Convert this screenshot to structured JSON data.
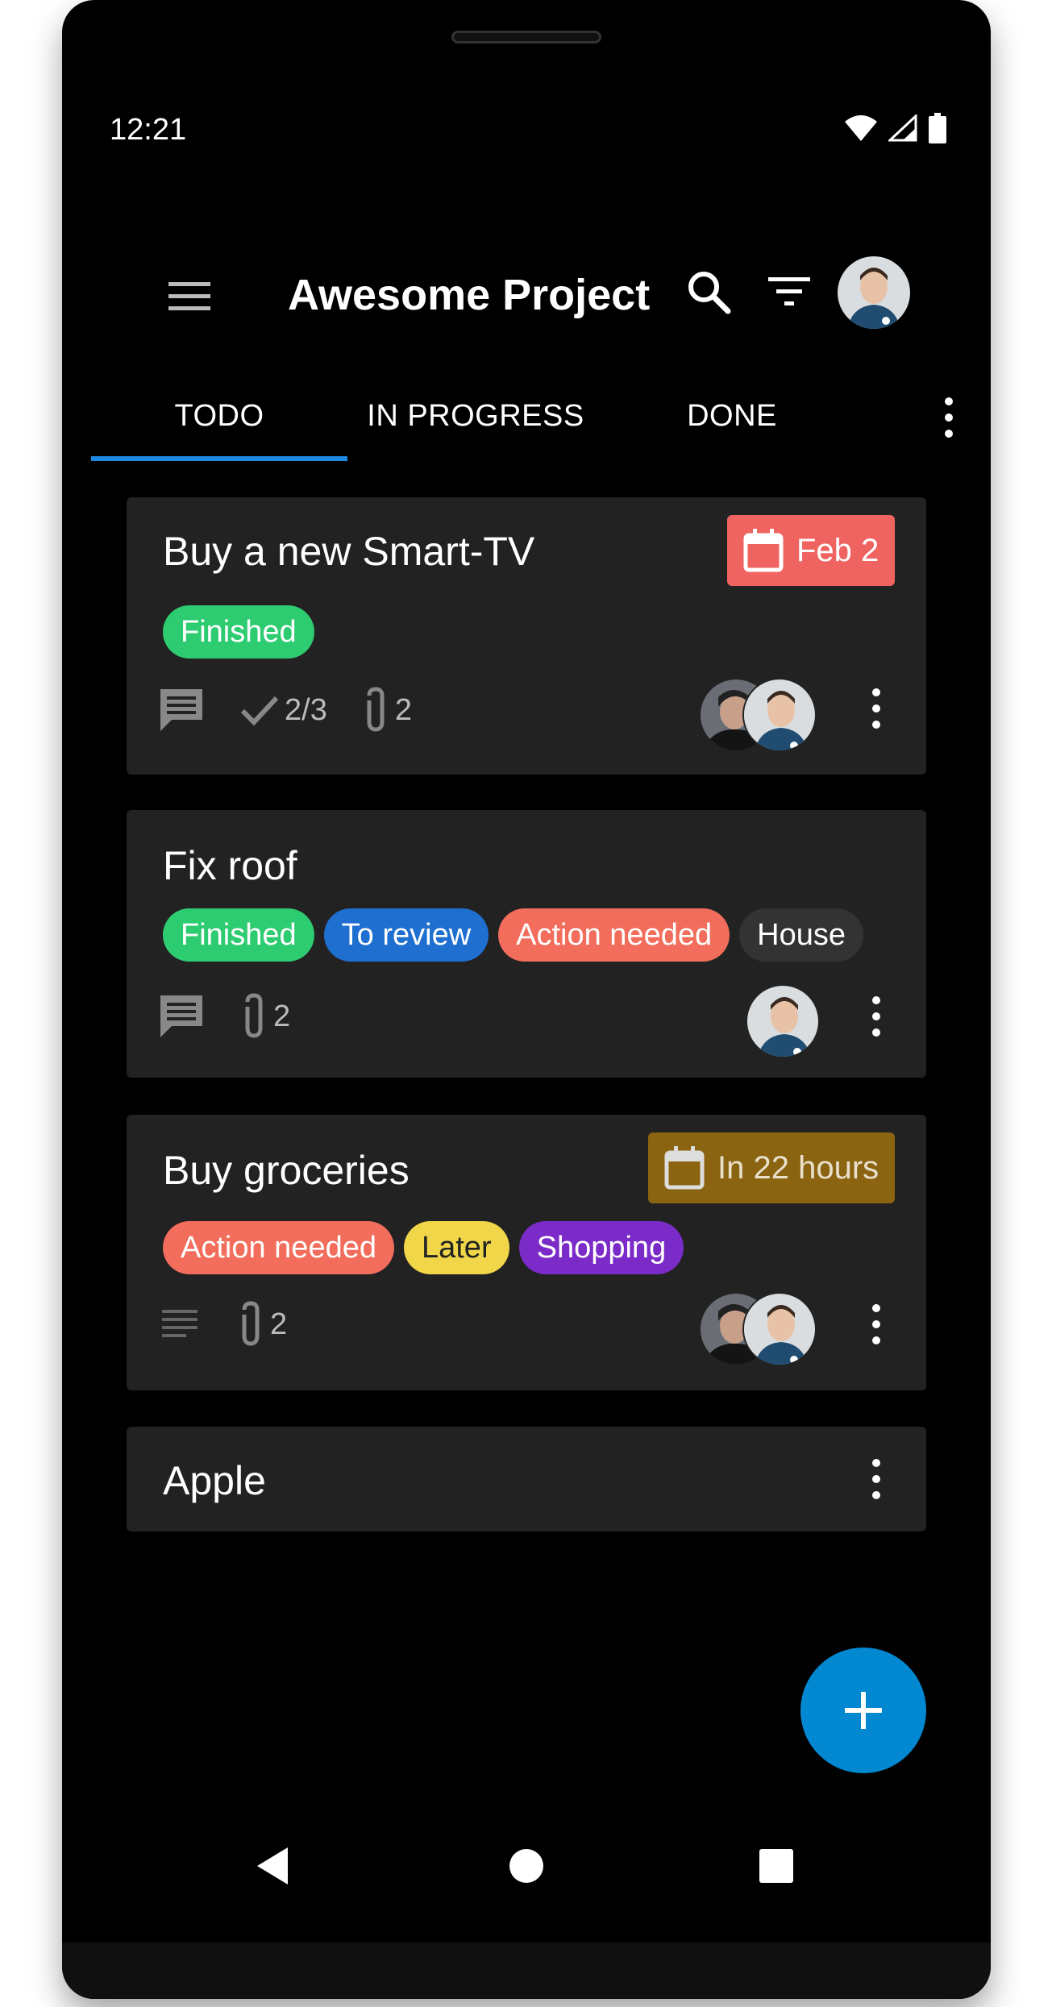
{
  "status_bar": {
    "time": "12:21"
  },
  "app_bar": {
    "title": "Awesome Project"
  },
  "tabs": [
    {
      "label": "TODO",
      "selected": true
    },
    {
      "label": "IN PROGRESS",
      "selected": false
    },
    {
      "label": "DONE",
      "selected": false
    }
  ],
  "cards": [
    {
      "title": "Buy a new Smart-TV",
      "date": "Feb 2",
      "date_color": "#ef6461",
      "labels": [
        {
          "text": "Finished",
          "bg": "#2ecc71",
          "fg": "#ffffff"
        }
      ],
      "checklist": "2/3",
      "attachments": "2"
    },
    {
      "title": "Fix roof",
      "labels": [
        {
          "text": "Finished",
          "bg": "#2ecc71",
          "fg": "#ffffff"
        },
        {
          "text": "To review",
          "bg": "#1e6fd0",
          "fg": "#ffffff"
        },
        {
          "text": "Action needed",
          "bg": "#f26d5b",
          "fg": "#ffffff"
        },
        {
          "text": "House",
          "bg": "#333333",
          "fg": "#ffffff"
        }
      ],
      "attachments": "2"
    },
    {
      "title": "Buy groceries",
      "date": "In 22 hours",
      "date_color": "#8a6410",
      "labels": [
        {
          "text": "Action needed",
          "bg": "#f26d5b",
          "fg": "#ffffff"
        },
        {
          "text": "Later",
          "bg": "#f0d648",
          "fg": "#222222"
        },
        {
          "text": "Shopping",
          "bg": "#7b2bc8",
          "fg": "#ffffff"
        }
      ],
      "attachments": "2"
    },
    {
      "title": "Apple"
    }
  ],
  "colors": {
    "accent": "#1e88e5",
    "fab": "#0288d1",
    "card_bg": "#222222"
  },
  "icons": {
    "menu": "menu-icon",
    "search": "search-icon",
    "filter": "filter-icon",
    "more": "more-vert-icon",
    "calendar": "calendar-icon",
    "comment": "comment-icon",
    "check": "check-icon",
    "attachment": "paperclip-icon",
    "description": "notes-icon",
    "add": "add-icon",
    "back": "nav-back-icon",
    "home": "nav-home-icon",
    "recents": "nav-recents-icon"
  }
}
